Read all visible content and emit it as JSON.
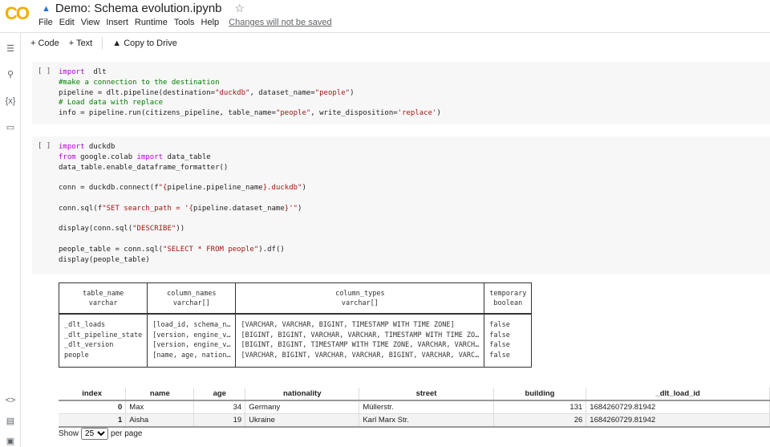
{
  "header": {
    "logo": "CO",
    "title": "Demo: Schema evolution.ipynb",
    "menu": [
      "File",
      "Edit",
      "View",
      "Insert",
      "Runtime",
      "Tools",
      "Help"
    ],
    "changes": "Changes will not be saved"
  },
  "toolbar": {
    "code": "+ Code",
    "text": "+ Text",
    "copy": "Copy to Drive"
  },
  "cells": [
    {
      "bracket": "[ ]",
      "lines": [
        [
          [
            "kw",
            "import"
          ],
          [
            "",
            "  dlt"
          ]
        ],
        [
          [
            "cm",
            "#make a connection to the destination"
          ]
        ],
        [
          [
            "",
            "pipeline = dlt.pipeline(destination="
          ],
          [
            "str",
            "\"duckdb\""
          ],
          [
            "",
            ", dataset_name="
          ],
          [
            "str",
            "\"people\""
          ],
          [
            "",
            ")"
          ]
        ],
        [
          [
            "cm",
            "# Load data with replace"
          ]
        ],
        [
          [
            "",
            "info = pipeline.run(citizens_pipeline, table_name="
          ],
          [
            "str",
            "\"people\""
          ],
          [
            "",
            ", write_disposition="
          ],
          [
            "str",
            "'replace'"
          ],
          [
            "",
            ")"
          ]
        ]
      ]
    },
    {
      "bracket": "[ ]",
      "lines": [
        [
          [
            "kw",
            "import"
          ],
          [
            "",
            " duckdb"
          ]
        ],
        [
          [
            "kw",
            "from"
          ],
          [
            "",
            " google.colab "
          ],
          [
            "kw",
            "import"
          ],
          [
            "",
            " data_table"
          ]
        ],
        [
          [
            "",
            "data_table.enable_dataframe_formatter()"
          ]
        ],
        [],
        [
          [
            "",
            "conn = duckdb.connect(f"
          ],
          [
            "str",
            "\"{"
          ],
          [
            "",
            "pipeline.pipeline_name"
          ],
          [
            "str",
            "}.duckdb\""
          ],
          [
            "",
            ")"
          ]
        ],
        [],
        [
          [
            "",
            "conn.sql(f"
          ],
          [
            "str",
            "\"SET search_path = '{"
          ],
          [
            "",
            "pipeline.dataset_name"
          ],
          [
            "str",
            "}'\""
          ],
          [
            "",
            ")"
          ]
        ],
        [],
        [
          [
            "",
            "display(conn.sql("
          ],
          [
            "str",
            "\"DESCRIBE\""
          ],
          [
            "",
            "))"
          ]
        ],
        [],
        [
          [
            "",
            "people_table = conn.sql("
          ],
          [
            "str",
            "\"SELECT * FROM people\""
          ],
          [
            "",
            ").df()"
          ]
        ],
        [
          [
            "",
            "display(people_table)"
          ]
        ]
      ]
    }
  ],
  "describe": {
    "headers": [
      [
        "table_name",
        "varchar"
      ],
      [
        "column_names",
        "varchar[]"
      ],
      [
        "column_types",
        "varchar[]"
      ],
      [
        "temporary",
        "boolean"
      ]
    ],
    "rows": [
      [
        "_dlt_loads",
        "[load_id, schema_n…",
        "[VARCHAR, VARCHAR, BIGINT, TIMESTAMP WITH TIME ZONE]",
        "false"
      ],
      [
        "_dlt_pipeline_state",
        "[version, engine_v…",
        "[BIGINT, BIGINT, VARCHAR, VARCHAR, TIMESTAMP WITH TIME ZO…",
        "false"
      ],
      [
        "_dlt_version",
        "[version, engine_v…",
        "[BIGINT, BIGINT, TIMESTAMP WITH TIME ZONE, VARCHAR, VARCH…",
        "false"
      ],
      [
        "people",
        "[name, age, nation…",
        "[VARCHAR, BIGINT, VARCHAR, VARCHAR, BIGINT, VARCHAR, VARC…",
        "false"
      ]
    ]
  },
  "people": {
    "headers": [
      "index",
      "name",
      "age",
      "nationality",
      "street",
      "building",
      "_dlt_load_id"
    ],
    "rows": [
      [
        "0",
        "Max",
        "34",
        "Germany",
        "Müllerstr.",
        "131",
        "1684260729.81942"
      ],
      [
        "1",
        "Aisha",
        "19",
        "Ukraine",
        "Karl Marx Str.",
        "26",
        "1684260729.81942"
      ]
    ]
  },
  "pager": {
    "show": "Show",
    "value": "25",
    "per_page": "per page"
  }
}
